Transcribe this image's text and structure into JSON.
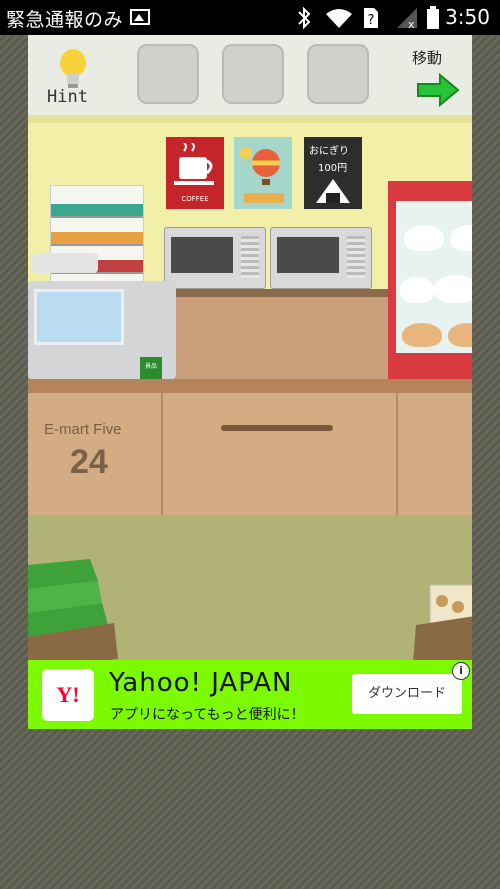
{
  "status_bar": {
    "notification": "緊急通報のみ",
    "time": "3:50",
    "icons": [
      "image-icon",
      "bluetooth-icon",
      "wifi-icon",
      "sim-unknown-icon",
      "signal-none-icon",
      "battery-icon"
    ]
  },
  "toolbar": {
    "hint_label": "Hint",
    "move_label": "移動",
    "item_slots": 3
  },
  "scene": {
    "poster_coffee": "COFFEE",
    "poster_onigiri_line1": "おにぎり",
    "poster_onigiri_line2": "100円",
    "store_name": "E-mart Five",
    "store_number": "24",
    "bag_label": "景品"
  },
  "ad": {
    "logo_text": "Y!",
    "title": "Yahoo! JAPAN",
    "subtitle": "アプリになってもっと便利に！",
    "download_label": "ダウンロード",
    "info_label": "i",
    "background": "#7cfa00"
  }
}
